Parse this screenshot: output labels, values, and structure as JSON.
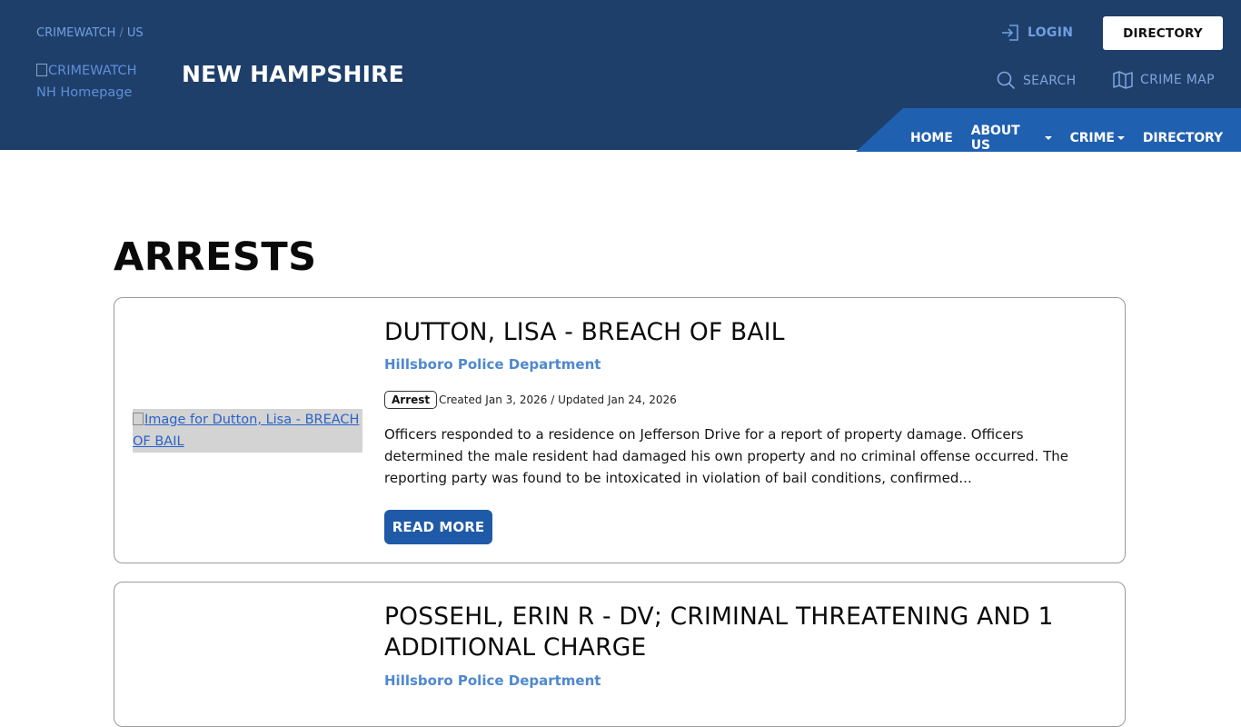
{
  "header": {
    "breadcrumb": [
      "CRIMEWATCH",
      "US"
    ],
    "breadcrumb_sep": "/",
    "logo_alt": "CRIMEWATCH NH Homepage",
    "state_title": "NEW HAMPSHIRE",
    "login_label": "LOGIN",
    "directory_button": "DIRECTORY",
    "search_label": "SEARCH",
    "crime_map_label": "CRIME MAP",
    "nav": {
      "home": "HOME",
      "about": "ABOUT US",
      "crime": "CRIME",
      "directory": "DIRECTORY"
    },
    "colors": {
      "header_bg": "#1f3f6b",
      "nav_band": "#2060b0",
      "link": "#6f9fe0"
    }
  },
  "main": {
    "page_title": "ARRESTS",
    "cards": [
      {
        "image_alt": "Image for Dutton, Lisa - BREACH OF BAIL",
        "title": "DUTTON, LISA - BREACH OF BAIL",
        "department": "Hillsboro Police Department",
        "tag": "Arrest",
        "meta": "Created Jan 3, 2026 / Updated Jan 24, 2026",
        "excerpt": "Officers responded to a residence on Jefferson Drive for a report of property damage. Officers determined the male resident had damaged his own property and no criminal offense occurred. The reporting party was found to be intoxicated in violation of bail conditions, confirmed...",
        "read_more": "READ MORE"
      },
      {
        "title": "POSSEHL, ERIN R - DV; CRIMINAL THREATENING AND 1 ADDITIONAL CHARGE",
        "department": "Hillsboro Police Department"
      }
    ]
  }
}
